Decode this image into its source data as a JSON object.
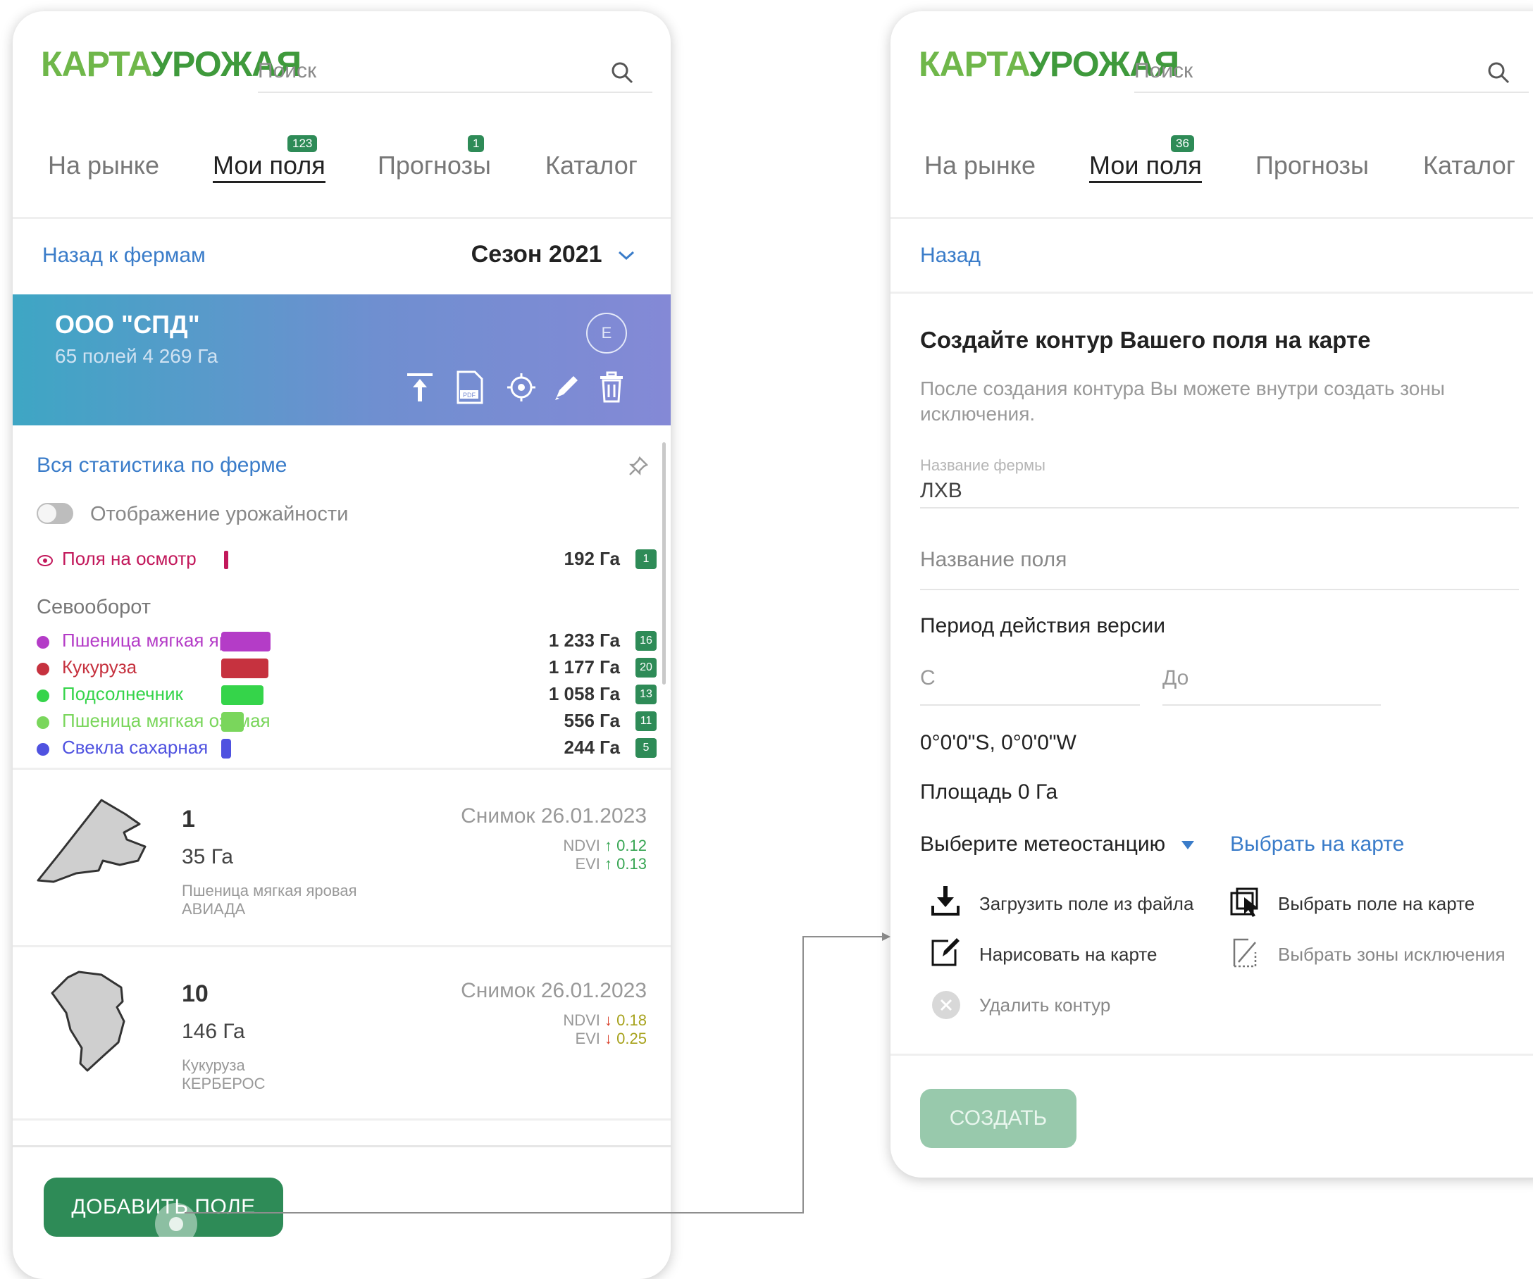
{
  "left": {
    "logo": {
      "part1": "КАРТА",
      "part2": "УРОЖАЯ"
    },
    "search": {
      "placeholder": "Поиск"
    },
    "tabs": [
      {
        "label": "На рынке",
        "badge": ""
      },
      {
        "label": "Мои поля",
        "badge": "123"
      },
      {
        "label": "Прогнозы",
        "badge": "1"
      },
      {
        "label": "Каталог",
        "badge": ""
      }
    ],
    "back_link": "Назад к фермам",
    "season": "Сезон 2021",
    "farm": {
      "name": "ООО \"СПД\"",
      "summary": "65 полей 4 269 Га",
      "avatar": "E"
    },
    "stats_title": "Вся статистика по ферме",
    "toggle_label": "Отображение урожайности",
    "inspection": {
      "label": "Поля на осмотр",
      "value": "192 Га",
      "badge": "1"
    },
    "rotation_title": "Севооборот",
    "crops": [
      {
        "name": "Пшеница мягкая яровая",
        "value": "1 233 Га",
        "count": "16",
        "color": "#b43cc7",
        "share": 1.0
      },
      {
        "name": "Кукуруза",
        "value": "1 177 Га",
        "count": "20",
        "color": "#c6323f",
        "share": 0.95
      },
      {
        "name": "Подсолнечник",
        "value": "1 058 Га",
        "count": "13",
        "color": "#35d44a",
        "share": 0.86
      },
      {
        "name": "Пшеница мягкая озимая",
        "value": "556 Га",
        "count": "11",
        "color": "#7ad65c",
        "share": 0.45
      },
      {
        "name": "Свекла сахарная",
        "value": "244 Га",
        "count": "5",
        "color": "#4f52e0",
        "share": 0.2
      }
    ],
    "fields": [
      {
        "number": "1",
        "area": "35 Га",
        "crop": "Пшеница мягкая яровая",
        "variety": "АВИАДА",
        "snapshot": "Снимок 26.01.2023",
        "ndvi_label": "NDVI",
        "ndvi_arrow": "↑",
        "ndvi": "0.12",
        "evi_label": "EVI",
        "evi_arrow": "↑",
        "evi": "0.13"
      },
      {
        "number": "10",
        "area": "146 Га",
        "crop": "Кукуруза",
        "variety": "КЕРБЕРОС",
        "snapshot": "Снимок 26.01.2023",
        "ndvi_label": "NDVI",
        "ndvi_arrow": "↓",
        "ndvi": "0.18",
        "evi_label": "EVI",
        "evi_arrow": "↓",
        "evi": "0.25"
      }
    ],
    "add_button": "ДОБАВИТЬ ПОЛЕ"
  },
  "right": {
    "logo": {
      "part1": "КАРТА",
      "part2": "УРОЖАЯ"
    },
    "search": {
      "placeholder": "Поиск"
    },
    "tabs": [
      {
        "label": "На рынке",
        "badge": ""
      },
      {
        "label": "Мои поля",
        "badge": "36"
      },
      {
        "label": "Прогнозы",
        "badge": ""
      },
      {
        "label": "Каталог",
        "badge": ""
      }
    ],
    "back_link": "Назад",
    "heading": "Создайте контур Вашего поля на карте",
    "description": "После создания контура Вы можете внутри создать зоны исключения.",
    "farm_name_label": "Название фермы",
    "farm_name_value": "ЛХВ",
    "field_name_placeholder": "Название поля",
    "period_title": "Период действия версии",
    "from_placeholder": "С",
    "to_placeholder": "До",
    "coordinates": "0°0'0\"S, 0°0'0\"W",
    "area": "Площадь 0 Га",
    "meteo_label": "Выберите метеостанцию",
    "meteo_map_link": "Выбрать на карте",
    "actions": {
      "upload": "Загрузить поле из файла",
      "select_field": "Выбрать поле на карте",
      "draw": "Нарисовать на карте",
      "select_zones": "Выбрать зоны исключения",
      "delete": "Удалить контур"
    },
    "create_button": "СОЗДАТЬ"
  },
  "colors": {
    "accent": "#3a7cc9",
    "brand_green": "#2e8b57",
    "logo_light": "#6fb74a",
    "logo_dark": "#3f9a3c",
    "inspection": "#c2185b"
  }
}
